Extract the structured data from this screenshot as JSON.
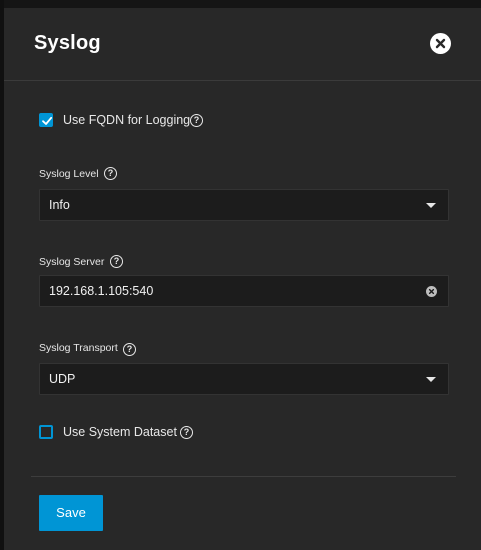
{
  "dialog": {
    "title": "Syslog",
    "close_icon": "close-icon"
  },
  "fields": {
    "use_fqdn": {
      "label": "Use FQDN for Logging",
      "checked": true,
      "help_icon": "question-circle-icon"
    },
    "syslog_level": {
      "label": "Syslog Level",
      "value": "Info",
      "help_icon": "question-circle-icon"
    },
    "syslog_server": {
      "label": "Syslog Server",
      "value": "192.168.1.105:540",
      "help_icon": "question-circle-icon"
    },
    "syslog_transport": {
      "label": "Syslog Transport",
      "value": "UDP",
      "help_icon": "question-circle-icon"
    },
    "use_system_dataset": {
      "label": "Use System Dataset",
      "checked": false,
      "help_icon": "question-circle-icon"
    }
  },
  "actions": {
    "save_label": "Save"
  },
  "colors": {
    "panel_background": "#282828",
    "input_background": "#1c1c1c",
    "accent": "#0095d5",
    "text": "#ffffff"
  }
}
